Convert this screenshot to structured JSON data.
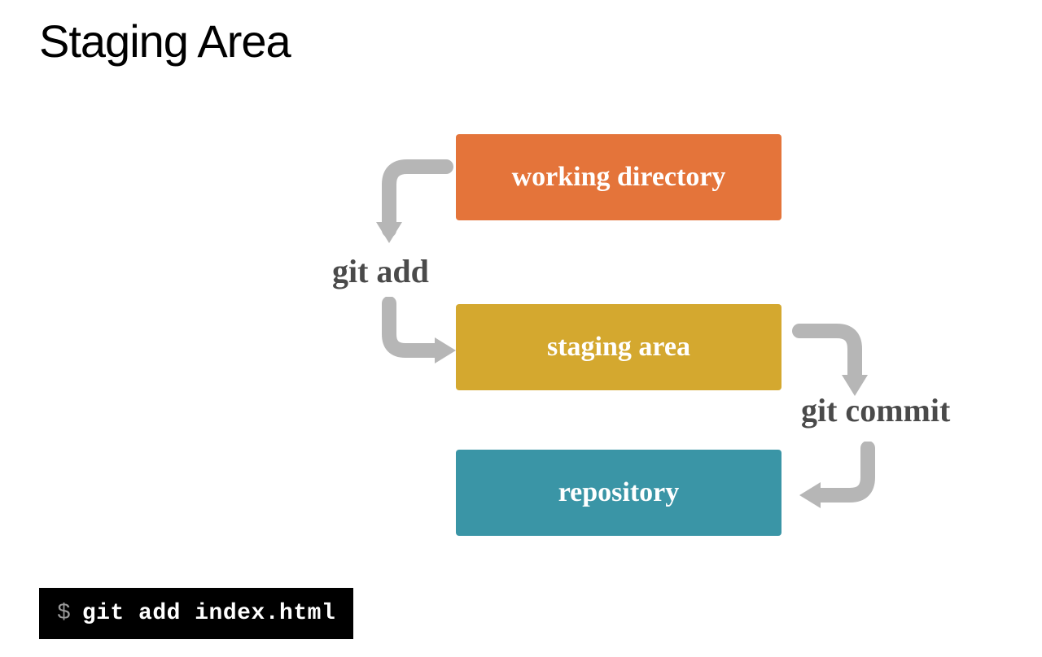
{
  "title": "Staging Area",
  "boxes": {
    "working": "working directory",
    "staging": "staging area",
    "repo": "repository"
  },
  "labels": {
    "add": "git add",
    "commit": "git commit"
  },
  "terminal": {
    "prompt": "$",
    "command": "git add index.html"
  },
  "colors": {
    "working": "#e4743a",
    "staging": "#d4a82f",
    "repo": "#3a95a6",
    "arrow": "#b6b6b6",
    "label": "#4a4a4a"
  }
}
